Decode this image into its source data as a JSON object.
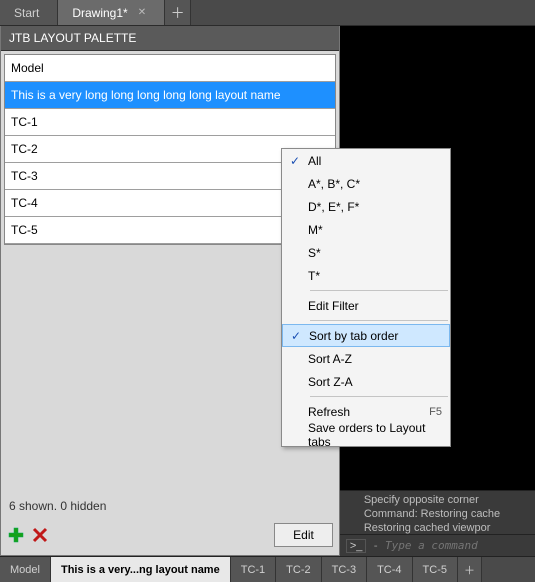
{
  "top_tabs": {
    "items": [
      {
        "label": "Start",
        "active": false
      },
      {
        "label": "Drawing1*",
        "active": true
      }
    ]
  },
  "palette": {
    "title": "JTB LAYOUT PALETTE",
    "rows": [
      "Model",
      "This is a very long long long long long layout name",
      "TC-1",
      "TC-2",
      "TC-3",
      "TC-4",
      "TC-5"
    ],
    "selected_index": 1,
    "status": "6 shown. 0 hidden",
    "edit_label": "Edit"
  },
  "context_menu": {
    "items": [
      {
        "label": "All",
        "checked": true
      },
      {
        "label": "A*, B*, C*"
      },
      {
        "label": "D*, E*, F*"
      },
      {
        "label": "M*"
      },
      {
        "label": "S*"
      },
      {
        "label": "T*"
      },
      {
        "sep": true
      },
      {
        "label": "Edit Filter"
      },
      {
        "sep": true
      },
      {
        "label": "Sort by tab order",
        "checked": true,
        "highlight": true
      },
      {
        "label": "Sort A-Z"
      },
      {
        "label": "Sort Z-A"
      },
      {
        "sep": true
      },
      {
        "label": "Refresh",
        "accel": "F5"
      },
      {
        "label": "Save orders to Layout tabs"
      }
    ]
  },
  "command": {
    "log": [
      "Specify opposite corner",
      "Command: Restoring cache",
      "Restoring cached viewpor"
    ],
    "placeholder": "Type a command"
  },
  "bottom_tabs": {
    "items": [
      "Model",
      "This is a very...ng layout name",
      "TC-1",
      "TC-2",
      "TC-3",
      "TC-4",
      "TC-5"
    ],
    "current_index": 1
  }
}
